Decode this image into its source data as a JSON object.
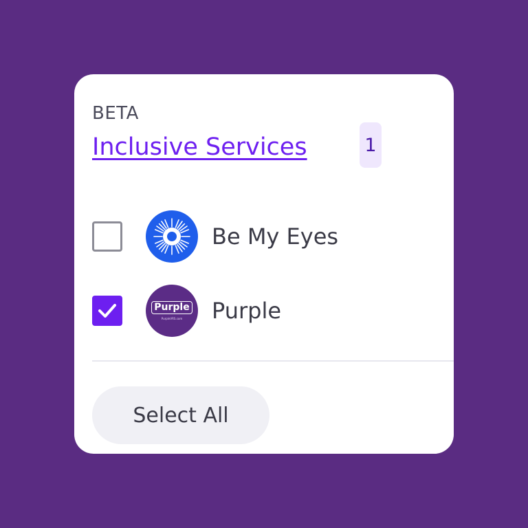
{
  "card": {
    "badge": "BETA",
    "title": "Inclusive Services",
    "count": "1"
  },
  "services": [
    {
      "label": "Be My Eyes",
      "checked": false,
      "icon": "be-my-eyes-logo"
    },
    {
      "label": "Purple",
      "checked": true,
      "icon": "purple-logo",
      "logo_text": "Purple",
      "logo_subtext": "PurpleVRS.com"
    }
  ],
  "actions": {
    "select_all_label": "Select All"
  },
  "colors": {
    "background": "#5a2c82",
    "accent": "#6d1ff0",
    "badge_bg": "#efe7fd",
    "be_my_eyes_blue": "#1f5eeb",
    "purple_logo_bg": "#5b2c86"
  }
}
